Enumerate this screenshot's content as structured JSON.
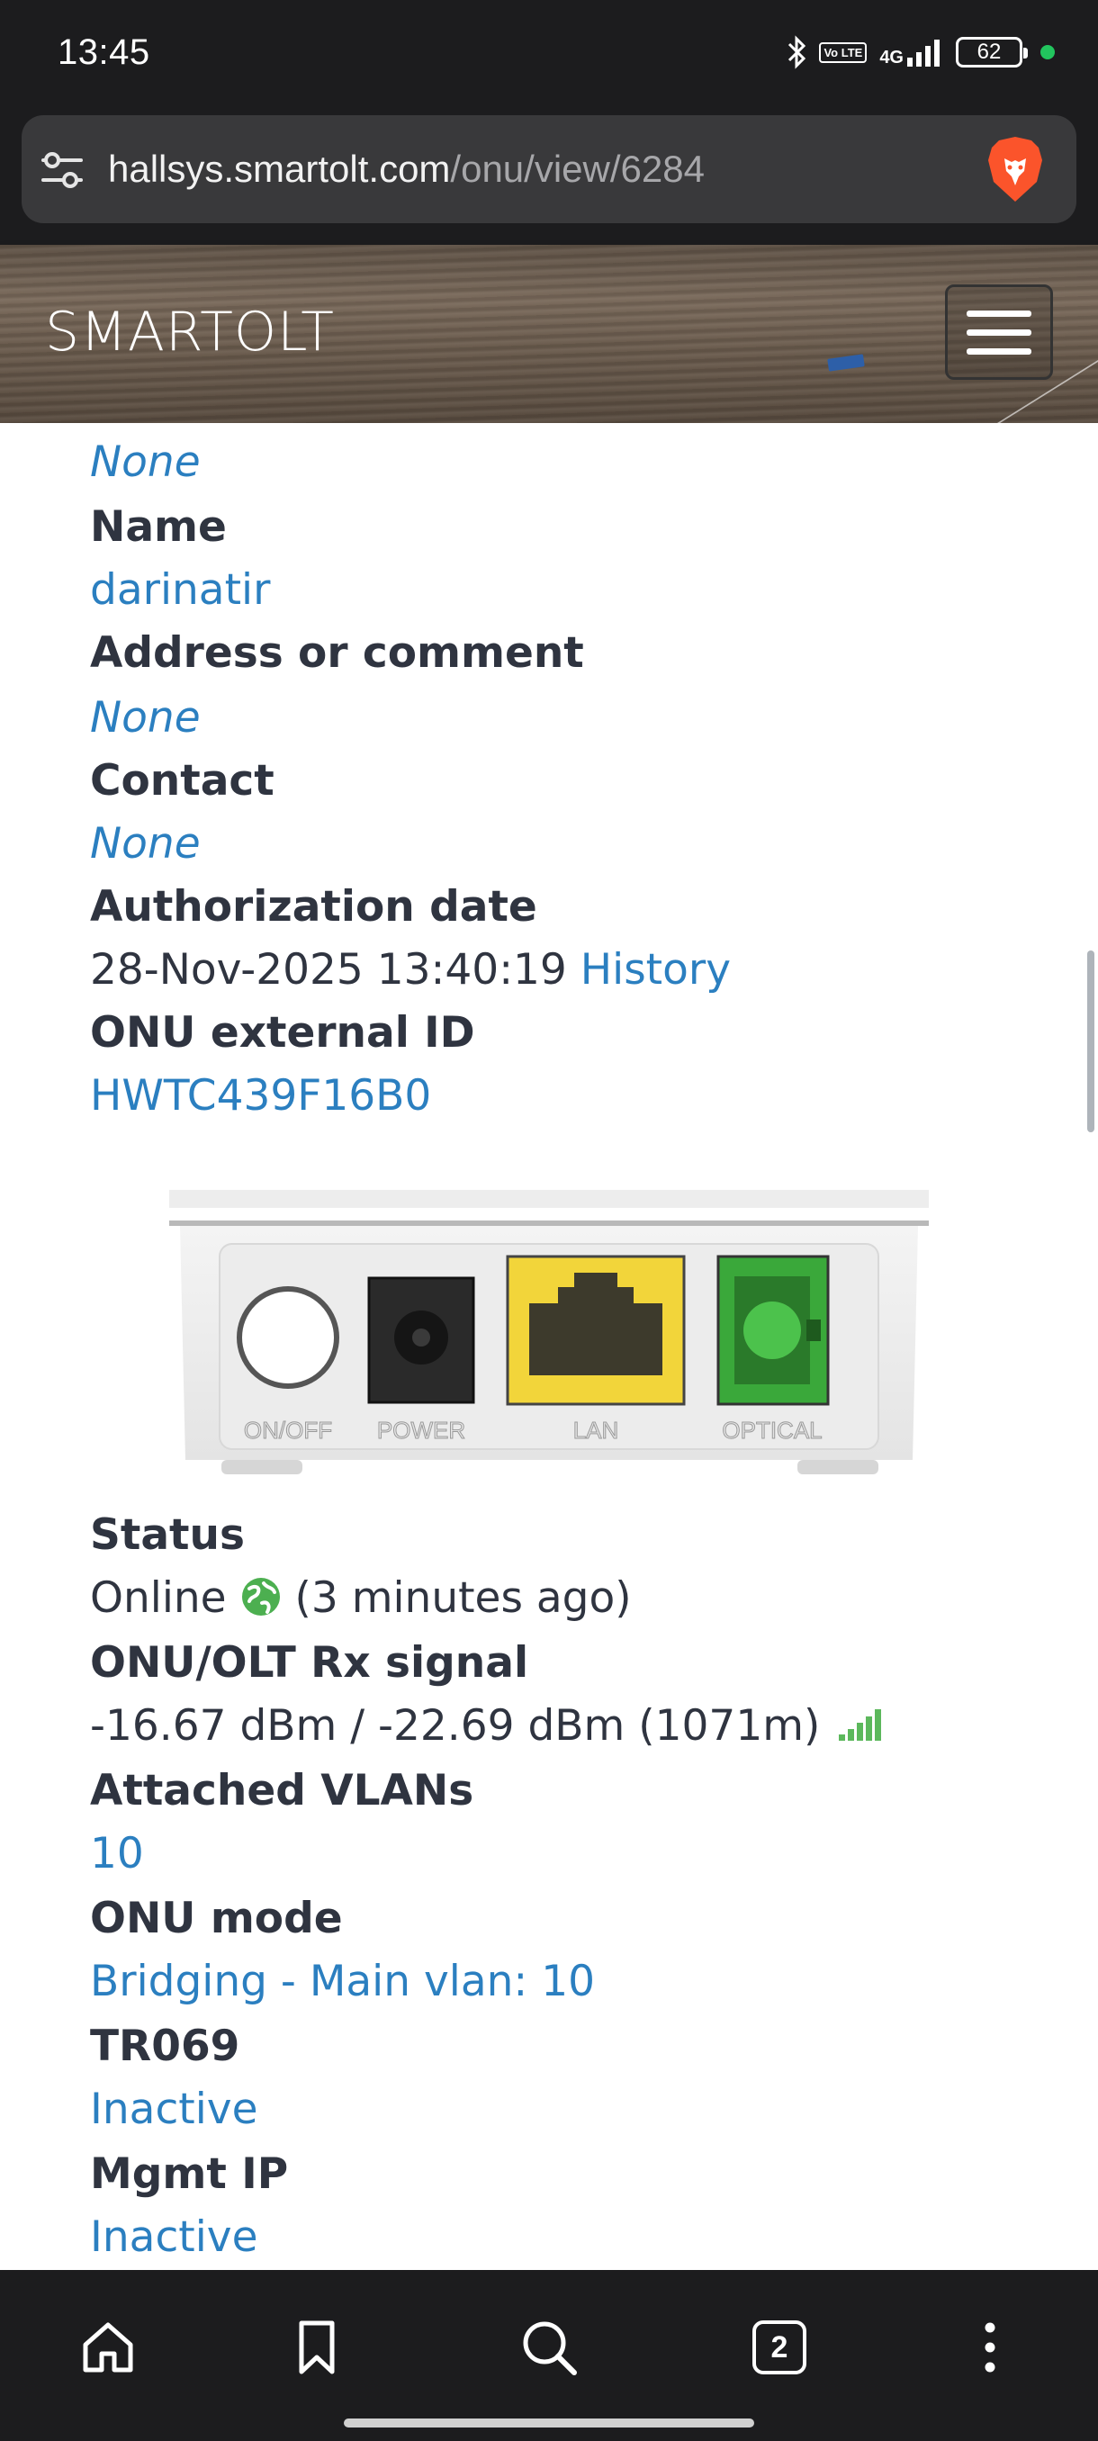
{
  "status_bar": {
    "time": "13:45",
    "network": "4G",
    "volte": "Vo LTE",
    "battery": "62",
    "icons": [
      "bluetooth-icon",
      "volte-icon",
      "signal-icon",
      "battery-icon",
      "privacy-dot-icon"
    ]
  },
  "browser": {
    "url_host": "hallsys.smartolt.com",
    "url_path": "/onu/view/6284",
    "tabs_count": "2"
  },
  "header": {
    "brand": "SMARTOLT"
  },
  "details": {
    "top_value": "None",
    "name_label": "Name",
    "name_value": "darinatir",
    "address_label": "Address or comment",
    "address_value": "None",
    "contact_label": "Contact",
    "contact_value": "None",
    "auth_label": "Authorization date",
    "auth_value": "28-Nov-2025 13:40:19",
    "auth_history": "History",
    "ext_id_label": "ONU external ID",
    "ext_id_value": "HWTC439F16B0"
  },
  "device": {
    "ports": [
      "ON/OFF",
      "POWER",
      "LAN",
      "OPTICAL"
    ],
    "colors": {
      "lan": "#f2d53a",
      "optical": "#4cc24c"
    }
  },
  "status": {
    "status_label": "Status",
    "status_value": "Online",
    "status_ago": "(3 minutes ago)",
    "signal_label": "ONU/OLT Rx signal",
    "signal_value": "-16.67 dBm / -22.69 dBm (1071m)",
    "vlans_label": "Attached VLANs",
    "vlans_value": "10",
    "mode_label": "ONU mode",
    "mode_value": "Bridging - Main vlan: 10",
    "tr069_label": "TR069",
    "tr069_value": "Inactive",
    "mgmt_label": "Mgmt IP",
    "mgmt_value": "Inactive"
  },
  "colors": {
    "link": "#2b7fc0",
    "label": "#2f3440",
    "online": "#4caf50"
  }
}
